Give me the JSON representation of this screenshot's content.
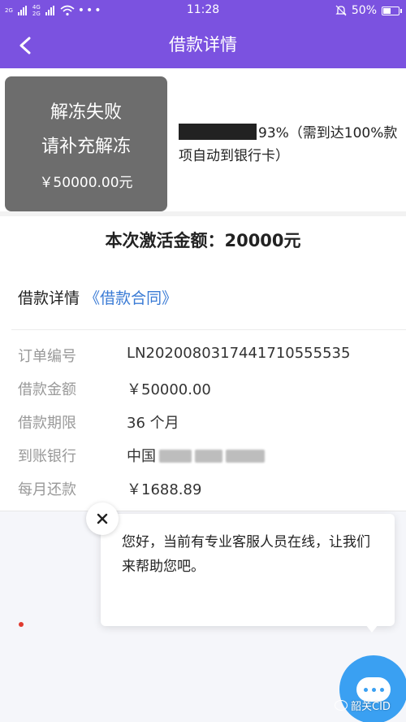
{
  "status_bar": {
    "signal_top": "2G",
    "signal_4g": "4G",
    "signal_bottom": "2G",
    "time": "11:28",
    "battery": "50%"
  },
  "nav": {
    "title": "借款详情"
  },
  "unfreeze": {
    "line1": "解冻失败",
    "line2": "请补充解冻",
    "amount": "￥50000.00元"
  },
  "notice": {
    "text": "93%（需到达100%款项自动到银行卡）"
  },
  "activation": {
    "text": "本次激活金额：20000元"
  },
  "contract": {
    "label": "借款详情",
    "link": "《借款合同》"
  },
  "details": [
    {
      "label": "订单编号",
      "value": "LN2020080317441710555535"
    },
    {
      "label": "借款金额",
      "value": "￥50000.00"
    },
    {
      "label": "借款期限",
      "value": "36 个月"
    },
    {
      "label": "到账银行",
      "value": "中国"
    },
    {
      "label": "每月还款",
      "value": "￥1688.89"
    }
  ],
  "chat": {
    "message": "您好，当前有专业客服人员在线，让我们来帮助您吧。"
  },
  "watermark": {
    "text": "韶关CID"
  },
  "colors": {
    "header": "#7b52e0",
    "failed_box": "#6d6d6d",
    "link": "#3a7bd5",
    "launcher": "#3aa0f2"
  }
}
